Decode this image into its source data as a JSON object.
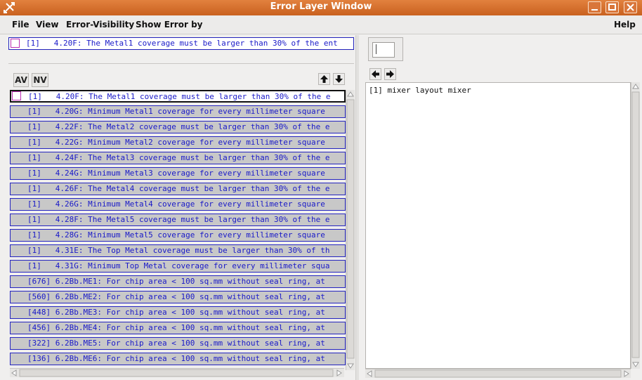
{
  "window": {
    "title": "Error Layer Window",
    "title_bar_color": "#d9763a",
    "app_icon": "tools-icon",
    "controls": [
      "minimize-icon",
      "maximize-icon",
      "close-icon"
    ]
  },
  "menubar": {
    "items": [
      "File",
      "View",
      "Error-Visibility",
      "Show Error by"
    ],
    "help": "Help"
  },
  "summary_row": {
    "text": "[1]   4.20F: The Metal1 coverage must be larger than 30% of the ent"
  },
  "toolbar": {
    "av_label": "AV",
    "nv_label": "NV",
    "up_icon": "arrow-up-icon",
    "down_icon": "arrow-down-icon"
  },
  "errors": [
    {
      "text": "[1]   4.20F: The Metal1 coverage must be larger than 30% of the e",
      "selected": true
    },
    {
      "text": "[1]   4.20G: Minimum Metal1 coverage for every millimeter square",
      "selected": false
    },
    {
      "text": "[1]   4.22F: The Metal2 coverage must be larger than 30% of the e",
      "selected": false
    },
    {
      "text": "[1]   4.22G: Minimum Metal2 coverage for every millimeter square",
      "selected": false
    },
    {
      "text": "[1]   4.24F: The Metal3 coverage must be larger than 30% of the e",
      "selected": false
    },
    {
      "text": "[1]   4.24G: Minimum Metal3 coverage for every millimeter square",
      "selected": false
    },
    {
      "text": "[1]   4.26F: The Metal4 coverage must be larger than 30% of the e",
      "selected": false
    },
    {
      "text": "[1]   4.26G: Minimum Metal4 coverage for every millimeter square",
      "selected": false
    },
    {
      "text": "[1]   4.28F: The Metal5 coverage must be larger than 30% of the e",
      "selected": false
    },
    {
      "text": "[1]   4.28G: Minimum Metal5 coverage for every millimeter square",
      "selected": false
    },
    {
      "text": "[1]   4.31E: The Top Metal coverage must be larger than 30% of th",
      "selected": false
    },
    {
      "text": "[1]   4.31G: Minimum Top Metal coverage for every millimeter squa",
      "selected": false
    },
    {
      "text": "[676] 6.2Bb.ME1: For chip area < 100 sq.mm without seal ring, at",
      "selected": false
    },
    {
      "text": "[560] 6.2Bb.ME2: For chip area < 100 sq.mm without seal ring, at",
      "selected": false
    },
    {
      "text": "[448] 6.2Bb.ME3: For chip area < 100 sq.mm without seal ring, at",
      "selected": false
    },
    {
      "text": "[456] 6.2Bb.ME4: For chip area < 100 sq.mm without seal ring, at",
      "selected": false
    },
    {
      "text": "[322] 6.2Bb.ME5: For chip area < 100 sq.mm without seal ring, at",
      "selected": false
    },
    {
      "text": "[136] 6.2Bb.ME6: For chip area < 100 sq.mm without seal ring, at",
      "selected": false
    }
  ],
  "detail": {
    "prev_icon": "arrow-left-icon",
    "next_icon": "arrow-right-icon",
    "text": "[1] mixer layout mixer"
  },
  "colors": {
    "row_text": "#1919c8",
    "row_border": "#2525c0",
    "row_bg": "#c8c8c8",
    "checkbox_border": "#bb2db2"
  }
}
